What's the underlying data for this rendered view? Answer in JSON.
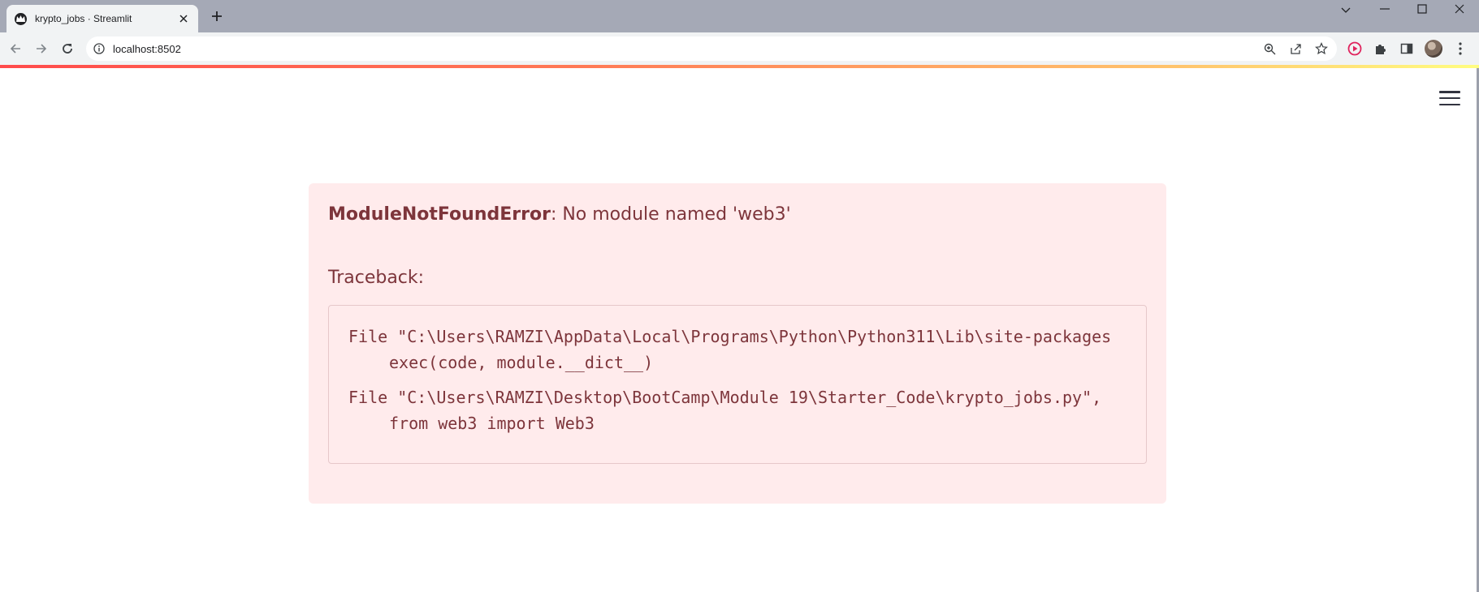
{
  "browser": {
    "tab": {
      "title": "krypto_jobs · Streamlit"
    },
    "address_bar": {
      "url": "localhost:8502"
    }
  },
  "error": {
    "name": "ModuleNotFoundError",
    "message": ": No module named 'web3'",
    "traceback_label": "Traceback:",
    "traceback": [
      {
        "file_line": "File \"C:\\Users\\RAMZI\\AppData\\Local\\Programs\\Python\\Python311\\Lib\\site-packages",
        "code_line": "exec(code, module.__dict__)"
      },
      {
        "file_line": "File \"C:\\Users\\RAMZI\\Desktop\\BootCamp\\Module 19\\Starter_Code\\krypto_jobs.py\",",
        "code_line": "from web3 import Web3"
      }
    ]
  },
  "colors": {
    "error_background": "#ffebec",
    "error_text": "#7d353b",
    "decoration_start": "#ff4b4b",
    "decoration_end": "#fffd80"
  },
  "icons": {
    "tab_favicon": "streamlit-crown-icon",
    "tab_close": "close-icon",
    "new_tab": "plus-icon",
    "back": "arrow-left-icon",
    "forward": "arrow-right-icon",
    "reload": "reload-icon",
    "site_info": "info-icon",
    "zoom": "zoom-icon",
    "share": "share-icon",
    "bookmark": "star-icon",
    "extension_record": "record-icon",
    "extensions": "puzzle-icon",
    "side_panel": "side-panel-icon",
    "chrome_menu": "vertical-dots-icon",
    "app_menu": "hamburger-icon"
  }
}
